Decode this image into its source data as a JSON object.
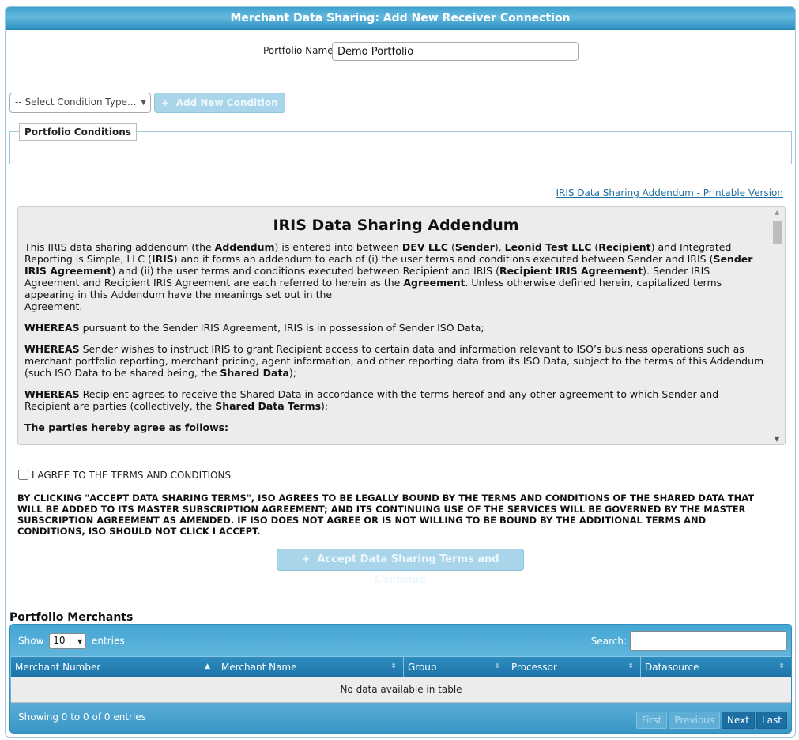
{
  "dialog": {
    "title": "Merchant Data Sharing: Add New Receiver Connection"
  },
  "portfolio": {
    "label": "Portfolio Name",
    "value": "Demo Portfolio"
  },
  "conditions": {
    "select_text": "-- Select Condition Type...",
    "add_button": "Add New Condition",
    "add_icon": "plus-icon",
    "legend": "Portfolio Conditions"
  },
  "printable_link": "IRIS Data Sharing Addendum - Printable Version",
  "addendum": {
    "title": "IRIS Data Sharing Addendum",
    "p1": {
      "a": "This IRIS data sharing addendum (the ",
      "b": "Addendum",
      "c": ") is entered into between ",
      "d": "DEV LLC",
      "e": " (",
      "f": "Sender",
      "g": "), ",
      "h": "Leonid Test LLC",
      "i": " (",
      "j": "Recipient",
      "k": ") and Integrated Reporting is Simple, LLC (",
      "l": "IRIS",
      "m": ") and it forms an addendum to each of (i) the user terms and conditions executed between Sender and IRIS (",
      "n": "Sender IRIS Agreement",
      "o": ") and (ii) the user terms and conditions executed between Recipient and IRIS (",
      "p": "Recipient IRIS Agreement",
      "q": "). Sender IRIS Agreement and Recipient IRIS Agreement are each referred to herein as the ",
      "r": "Agreement",
      "s": ". Unless otherwise defined herein, capitalized terms appearing in this Addendum have the meanings set out in the",
      "t": "Agreement."
    },
    "p2": {
      "bold": "WHEREAS",
      "text": " pursuant to the Sender IRIS Agreement, IRIS is in possession of Sender ISO Data;"
    },
    "p3": {
      "bold": "WHEREAS",
      "text": " Sender wishes to instruct IRIS to grant Recipient access to certain data and information relevant to ISO’s business operations such as merchant portfolio reporting, merchant pricing, agent information, and other reporting data from its ISO Data, subject to the terms of this Addendum (such ISO Data to be shared being, the ",
      "bold2": "Shared Data",
      "end": ");"
    },
    "p4": {
      "bold": "WHEREAS",
      "text": " Recipient agrees to receive the Shared Data in accordance with the terms hereof and any other agreement to which Sender and Recipient are parties (collectively, the ",
      "bold2": "Shared Data Terms",
      "end": ");"
    },
    "p5": "The parties hereby agree as follows:"
  },
  "agree": {
    "label": "I AGREE TO THE TERMS AND CONDITIONS",
    "legal": "BY CLICKING \"ACCEPT DATA SHARING TERMS\", ISO AGREES TO BE LEGALLY BOUND BY THE TERMS AND CONDITIONS OF THE SHARED DATA THAT WILL BE ADDED TO ITS MASTER SUBSCRIPTION AGREEMENT; AND ITS CONTINUING USE OF THE SERVICES WILL BE GOVERNED BY THE MASTER SUBSCRIPTION AGREEMENT AS AMENDED. IF ISO DOES NOT AGREE OR IS NOT WILLING TO BE BOUND BY THE ADDITIONAL TERMS AND CONDITIONS, ISO SHOULD NOT CLICK I ACCEPT.",
    "accept_button": "Accept Data Sharing Terms and Continue"
  },
  "merchants": {
    "title": "Portfolio Merchants",
    "show_label": "Show",
    "show_value": "10",
    "entries_label": "entries",
    "search_label": "Search:",
    "columns": [
      "Merchant Number",
      "Merchant Name",
      "Group",
      "Processor",
      "Datasource"
    ],
    "empty_text": "No data available in table",
    "info": "Showing 0 to 0 of 0 entries",
    "pager": {
      "first": "First",
      "previous": "Previous",
      "next": "Next",
      "last": "Last"
    }
  },
  "colors": {
    "header": "#3ea2cf",
    "table_head": "#1e73a8",
    "link": "#1f6fa5",
    "disabled_button": "#a9d5ea"
  }
}
